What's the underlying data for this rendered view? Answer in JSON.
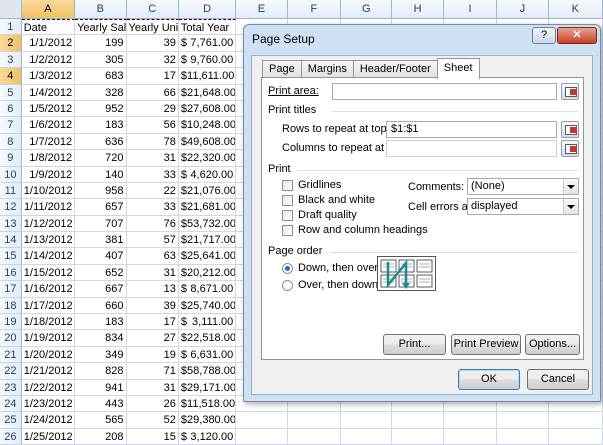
{
  "columns": [
    {
      "letter": "A",
      "width": 54,
      "selected": true
    },
    {
      "letter": "B",
      "width": 52
    },
    {
      "letter": "C",
      "width": 53
    },
    {
      "letter": "D",
      "width": 58
    },
    {
      "letter": "E",
      "width": 52
    },
    {
      "letter": "F",
      "width": 54
    },
    {
      "letter": "G",
      "width": 52
    },
    {
      "letter": "H",
      "width": 52
    },
    {
      "letter": "I",
      "width": 54
    },
    {
      "letter": "J",
      "width": 52
    },
    {
      "letter": "K",
      "width": 55
    }
  ],
  "header_row": {
    "num": "1",
    "cells": [
      "Date",
      "Yearly Sales",
      "Yearly Units",
      "Total Year"
    ]
  },
  "rows": [
    {
      "num": "2",
      "date": "1/1/2012",
      "sales": "199",
      "units": "39",
      "total": "7,761.00"
    },
    {
      "num": "3",
      "date": "1/2/2012",
      "sales": "305",
      "units": "32",
      "total": "9,760.00"
    },
    {
      "num": "4",
      "date": "1/3/2012",
      "sales": "683",
      "units": "17",
      "total": "11,611.00"
    },
    {
      "num": "5",
      "date": "1/4/2012",
      "sales": "328",
      "units": "66",
      "total": "21,648.00"
    },
    {
      "num": "6",
      "date": "1/5/2012",
      "sales": "952",
      "units": "29",
      "total": "27,608.00"
    },
    {
      "num": "7",
      "date": "1/6/2012",
      "sales": "183",
      "units": "56",
      "total": "10,248.00"
    },
    {
      "num": "8",
      "date": "1/7/2012",
      "sales": "636",
      "units": "78",
      "total": "49,608.00"
    },
    {
      "num": "9",
      "date": "1/8/2012",
      "sales": "720",
      "units": "31",
      "total": "22,320.00"
    },
    {
      "num": "10",
      "date": "1/9/2012",
      "sales": "140",
      "units": "33",
      "total": "4,620.00"
    },
    {
      "num": "11",
      "date": "1/10/2012",
      "sales": "958",
      "units": "22",
      "total": "21,076.00"
    },
    {
      "num": "12",
      "date": "1/11/2012",
      "sales": "657",
      "units": "33",
      "total": "21,681.00"
    },
    {
      "num": "13",
      "date": "1/12/2012",
      "sales": "707",
      "units": "76",
      "total": "53,732.00"
    },
    {
      "num": "14",
      "date": "1/13/2012",
      "sales": "381",
      "units": "57",
      "total": "21,717.00"
    },
    {
      "num": "15",
      "date": "1/14/2012",
      "sales": "407",
      "units": "63",
      "total": "25,641.00"
    },
    {
      "num": "16",
      "date": "1/15/2012",
      "sales": "652",
      "units": "31",
      "total": "20,212.00"
    },
    {
      "num": "17",
      "date": "1/16/2012",
      "sales": "667",
      "units": "13",
      "total": "8,671.00"
    },
    {
      "num": "18",
      "date": "1/17/2012",
      "sales": "660",
      "units": "39",
      "total": "25,740.00"
    },
    {
      "num": "19",
      "date": "1/18/2012",
      "sales": "183",
      "units": "17",
      "total": "3,111.00"
    },
    {
      "num": "20",
      "date": "1/19/2012",
      "sales": "834",
      "units": "27",
      "total": "22,518.00"
    },
    {
      "num": "21",
      "date": "1/20/2012",
      "sales": "349",
      "units": "19",
      "total": "6,631.00"
    },
    {
      "num": "22",
      "date": "1/21/2012",
      "sales": "828",
      "units": "71",
      "total": "58,788.00"
    },
    {
      "num": "23",
      "date": "1/22/2012",
      "sales": "941",
      "units": "31",
      "total": "29,171.00"
    },
    {
      "num": "24",
      "date": "1/23/2012",
      "sales": "443",
      "units": "26",
      "total": "11,518.00"
    },
    {
      "num": "25",
      "date": "1/24/2012",
      "sales": "565",
      "units": "52",
      "total": "29,380.00"
    },
    {
      "num": "26",
      "date": "1/25/2012",
      "sales": "208",
      "units": "15",
      "total": "3,120.00"
    }
  ],
  "currency_symbol": "$",
  "dialog": {
    "title": "Page Setup",
    "help_glyph": "?",
    "close_glyph": "✕",
    "tabs": [
      "Page",
      "Margins",
      "Header/Footer",
      "Sheet"
    ],
    "active_tab": "Sheet",
    "print_area_label": "Print area:",
    "print_area_value": "",
    "print_titles_label": "Print titles",
    "rows_repeat_label": "Rows to repeat at top:",
    "rows_repeat_value": "$1:$1",
    "cols_repeat_label": "Columns to repeat at left:",
    "cols_repeat_value": "",
    "print_label": "Print",
    "gridlines_label": "Gridlines",
    "black_white_label": "Black and white",
    "draft_label": "Draft quality",
    "row_col_headings_label": "Row and column headings",
    "comments_label": "Comments:",
    "comments_value": "(None)",
    "cell_errors_label": "Cell errors as:",
    "cell_errors_value": "displayed",
    "page_order_label": "Page order",
    "down_over_label": "Down, then over",
    "over_down_label": "Over, then down",
    "print_button": "Print...",
    "print_preview_button": "Print Preview",
    "options_button": "Options...",
    "ok_button": "OK",
    "cancel_button": "Cancel"
  },
  "colors": {
    "accent_selected_header": "#f1c15f",
    "page_order_arrow": "#1a8a8a"
  }
}
